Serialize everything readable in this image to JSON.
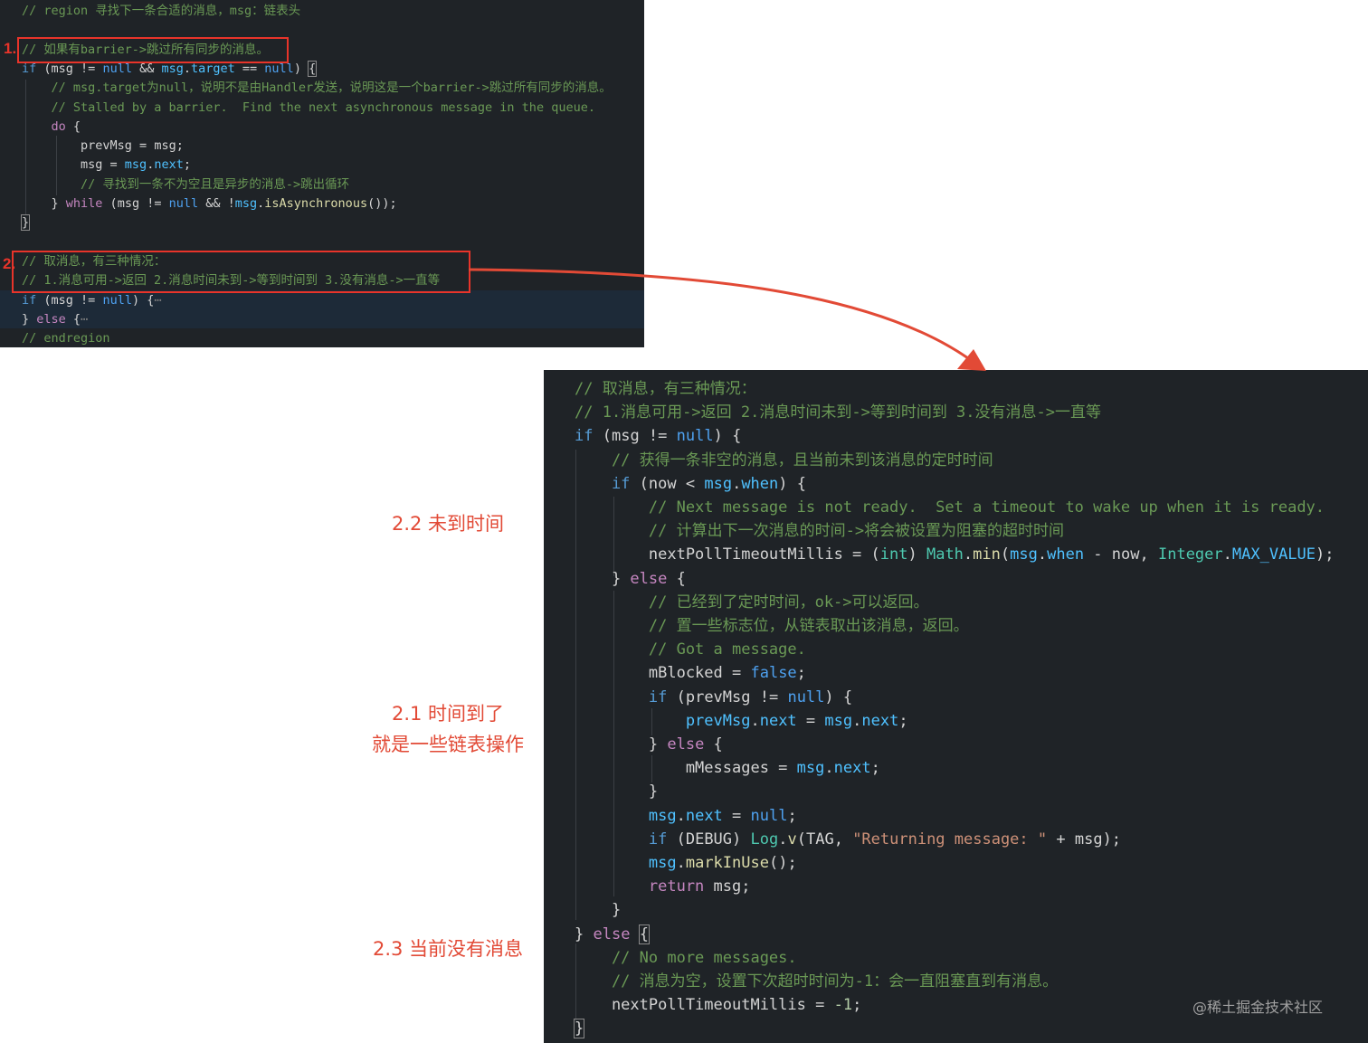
{
  "colors": {
    "background": "#1f2327",
    "annotation_red": "#e24a36",
    "box_red": "#e8342a"
  },
  "top_panel": {
    "lines": [
      {
        "t": [
          [
            "com",
            "// region 寻找下一条合适的消息，msg：链表头"
          ]
        ]
      },
      {
        "t": []
      },
      {
        "t": [
          [
            "com",
            "// 如果有barrier->跳过所有同步的消息。"
          ]
        ]
      },
      {
        "t": [
          [
            "kw2",
            "if"
          ],
          [
            "pun",
            " ("
          ],
          [
            "var",
            "msg"
          ],
          [
            "pun",
            " != "
          ],
          [
            "lit",
            "null"
          ],
          [
            "pun",
            " && "
          ],
          [
            "fld",
            "msg"
          ],
          [
            "pun",
            "."
          ],
          [
            "fld",
            "target"
          ],
          [
            "pun",
            " == "
          ],
          [
            "lit",
            "null"
          ],
          [
            "pun",
            ") "
          ],
          [
            "brk",
            "{"
          ]
        ]
      },
      {
        "t": [
          [
            "com",
            "    // msg.target为null，说明不是由Handler发送，说明这是一个barrier->跳过所有同步的消息。"
          ]
        ]
      },
      {
        "t": [
          [
            "com",
            "    // Stalled by a barrier.  Find the next asynchronous message in the queue."
          ]
        ]
      },
      {
        "t": [
          [
            "kw",
            "    do"
          ],
          [
            "pun",
            " {"
          ]
        ]
      },
      {
        "t": [
          [
            "var",
            "        prevMsg"
          ],
          [
            "pun",
            " = "
          ],
          [
            "var",
            "msg"
          ],
          [
            "pun",
            ";"
          ]
        ]
      },
      {
        "t": [
          [
            "var",
            "        msg"
          ],
          [
            "pun",
            " = "
          ],
          [
            "fld",
            "msg"
          ],
          [
            "pun",
            "."
          ],
          [
            "fld",
            "next"
          ],
          [
            "pun",
            ";"
          ]
        ]
      },
      {
        "t": [
          [
            "com",
            "        // 寻找到一条不为空且是异步的消息->跳出循环"
          ]
        ]
      },
      {
        "t": [
          [
            "pun",
            "    } "
          ],
          [
            "kw",
            "while"
          ],
          [
            "pun",
            " ("
          ],
          [
            "var",
            "msg"
          ],
          [
            "pun",
            " != "
          ],
          [
            "lit",
            "null"
          ],
          [
            "pun",
            " && !"
          ],
          [
            "fld",
            "msg"
          ],
          [
            "pun",
            "."
          ],
          [
            "fn",
            "isAsynchronous"
          ],
          [
            "pun",
            "());"
          ]
        ]
      },
      {
        "t": [
          [
            "brk",
            "}"
          ]
        ]
      },
      {
        "t": []
      },
      {
        "t": [
          [
            "com",
            "// 取消息，有三种情况："
          ]
        ]
      },
      {
        "t": [
          [
            "com",
            "// 1.消息可用->返回 2.消息时间未到->等到时间到 3.没有消息->一直等"
          ]
        ]
      },
      {
        "t": [
          [
            "kw2",
            "if"
          ],
          [
            "pun",
            " ("
          ],
          [
            "var",
            "msg"
          ],
          [
            "pun",
            " != "
          ],
          [
            "lit",
            "null"
          ],
          [
            "pun",
            ") {"
          ],
          [
            "dim",
            "⋯"
          ]
        ]
      },
      {
        "t": [
          [
            "pun",
            "} "
          ],
          [
            "kw",
            "else"
          ],
          [
            "pun",
            " {"
          ],
          [
            "dim",
            "⋯"
          ]
        ]
      },
      {
        "t": [
          [
            "com",
            "// endregion"
          ]
        ]
      }
    ]
  },
  "bottom_panel": {
    "lines": [
      {
        "t": [
          [
            "com",
            "// 取消息，有三种情况："
          ]
        ]
      },
      {
        "t": [
          [
            "com",
            "// 1.消息可用->返回 2.消息时间未到->等到时间到 3.没有消息->一直等"
          ]
        ]
      },
      {
        "t": [
          [
            "kw2",
            "if"
          ],
          [
            "pun",
            " ("
          ],
          [
            "var",
            "msg"
          ],
          [
            "pun",
            " != "
          ],
          [
            "lit",
            "null"
          ],
          [
            "pun",
            ") {"
          ]
        ]
      },
      {
        "t": [
          [
            "com",
            "    // 获得一条非空的消息，且当前未到该消息的定时时间"
          ]
        ]
      },
      {
        "t": [
          [
            "kw2",
            "    if"
          ],
          [
            "pun",
            " ("
          ],
          [
            "var",
            "now"
          ],
          [
            "pun",
            " < "
          ],
          [
            "fld",
            "msg"
          ],
          [
            "pun",
            "."
          ],
          [
            "fld",
            "when"
          ],
          [
            "pun",
            ") {"
          ]
        ]
      },
      {
        "t": [
          [
            "com",
            "        // Next message is not ready.  Set a timeout to wake up when it is ready."
          ]
        ]
      },
      {
        "t": [
          [
            "com",
            "        // 计算出下一次消息的时间->将会被设置为阻塞的超时时间"
          ]
        ]
      },
      {
        "t": [
          [
            "var",
            "        nextPollTimeoutMillis"
          ],
          [
            "pun",
            " = ("
          ],
          [
            "typ",
            "int"
          ],
          [
            "pun",
            ") "
          ],
          [
            "typ",
            "Math"
          ],
          [
            "pun",
            "."
          ],
          [
            "fn",
            "min"
          ],
          [
            "pun",
            "("
          ],
          [
            "fld",
            "msg"
          ],
          [
            "pun",
            "."
          ],
          [
            "fld",
            "when"
          ],
          [
            "pun",
            " - "
          ],
          [
            "var",
            "now"
          ],
          [
            "pun",
            ", "
          ],
          [
            "typ",
            "Integer"
          ],
          [
            "pun",
            "."
          ],
          [
            "fld",
            "MAX_VALUE"
          ],
          [
            "pun",
            ");"
          ]
        ]
      },
      {
        "t": [
          [
            "pun",
            "    } "
          ],
          [
            "kw",
            "else"
          ],
          [
            "pun",
            " {"
          ]
        ]
      },
      {
        "t": [
          [
            "com",
            "        // 已经到了定时时间，ok->可以返回。"
          ]
        ]
      },
      {
        "t": [
          [
            "com",
            "        // 置一些标志位，从链表取出该消息，返回。"
          ]
        ]
      },
      {
        "t": [
          [
            "com",
            "        // Got a message."
          ]
        ]
      },
      {
        "t": [
          [
            "var",
            "        mBlocked"
          ],
          [
            "pun",
            " = "
          ],
          [
            "lit",
            "false"
          ],
          [
            "pun",
            ";"
          ]
        ]
      },
      {
        "t": [
          [
            "kw2",
            "        if"
          ],
          [
            "pun",
            " ("
          ],
          [
            "var",
            "prevMsg"
          ],
          [
            "pun",
            " != "
          ],
          [
            "lit",
            "null"
          ],
          [
            "pun",
            ") {"
          ]
        ]
      },
      {
        "t": [
          [
            "fld",
            "            prevMsg"
          ],
          [
            "pun",
            "."
          ],
          [
            "fld",
            "next"
          ],
          [
            "pun",
            " = "
          ],
          [
            "fld",
            "msg"
          ],
          [
            "pun",
            "."
          ],
          [
            "fld",
            "next"
          ],
          [
            "pun",
            ";"
          ]
        ]
      },
      {
        "t": [
          [
            "pun",
            "        } "
          ],
          [
            "kw",
            "else"
          ],
          [
            "pun",
            " {"
          ]
        ]
      },
      {
        "t": [
          [
            "var",
            "            mMessages"
          ],
          [
            "pun",
            " = "
          ],
          [
            "fld",
            "msg"
          ],
          [
            "pun",
            "."
          ],
          [
            "fld",
            "next"
          ],
          [
            "pun",
            ";"
          ]
        ]
      },
      {
        "t": [
          [
            "pun",
            "        }"
          ]
        ]
      },
      {
        "t": [
          [
            "fld",
            "        msg"
          ],
          [
            "pun",
            "."
          ],
          [
            "fld",
            "next"
          ],
          [
            "pun",
            " = "
          ],
          [
            "lit",
            "null"
          ],
          [
            "pun",
            ";"
          ]
        ]
      },
      {
        "t": [
          [
            "kw2",
            "        if"
          ],
          [
            "pun",
            " ("
          ],
          [
            "var",
            "DEBUG"
          ],
          [
            "pun",
            ") "
          ],
          [
            "typ",
            "Log"
          ],
          [
            "pun",
            "."
          ],
          [
            "fn",
            "v"
          ],
          [
            "pun",
            "("
          ],
          [
            "var",
            "TAG"
          ],
          [
            "pun",
            ", "
          ],
          [
            "str",
            "\"Returning message: \""
          ],
          [
            "pun",
            " + "
          ],
          [
            "var",
            "msg"
          ],
          [
            "pun",
            ");"
          ]
        ]
      },
      {
        "t": [
          [
            "fld",
            "        msg"
          ],
          [
            "pun",
            "."
          ],
          [
            "fn",
            "markInUse"
          ],
          [
            "pun",
            "();"
          ]
        ]
      },
      {
        "t": [
          [
            "kw",
            "        return"
          ],
          [
            "pun",
            " "
          ],
          [
            "var",
            "msg"
          ],
          [
            "pun",
            ";"
          ]
        ]
      },
      {
        "t": [
          [
            "pun",
            "    }"
          ]
        ]
      },
      {
        "t": [
          [
            "pun",
            "} "
          ],
          [
            "kw",
            "else"
          ],
          [
            "pun",
            " "
          ],
          [
            "brk",
            "{"
          ]
        ]
      },
      {
        "t": [
          [
            "com",
            "    // No more messages."
          ]
        ]
      },
      {
        "t": [
          [
            "com",
            "    // 消息为空，设置下次超时时间为-1：会一直阻塞直到有消息。"
          ]
        ]
      },
      {
        "t": [
          [
            "var",
            "    nextPollTimeoutMillis"
          ],
          [
            "pun",
            " = "
          ],
          [
            "num",
            "-1"
          ],
          [
            "pun",
            ";"
          ]
        ]
      },
      {
        "t": [
          [
            "brk",
            "}"
          ]
        ]
      }
    ]
  },
  "markers": {
    "first": "1.",
    "second": "2."
  },
  "annotations": {
    "not_yet_time": "2.2 未到时间",
    "time_arrived": "2.1 时间到了",
    "list_ops": "就是一些链表操作",
    "no_message": "2.3 当前没有消息"
  },
  "watermark": "@稀土掘金技术社区"
}
